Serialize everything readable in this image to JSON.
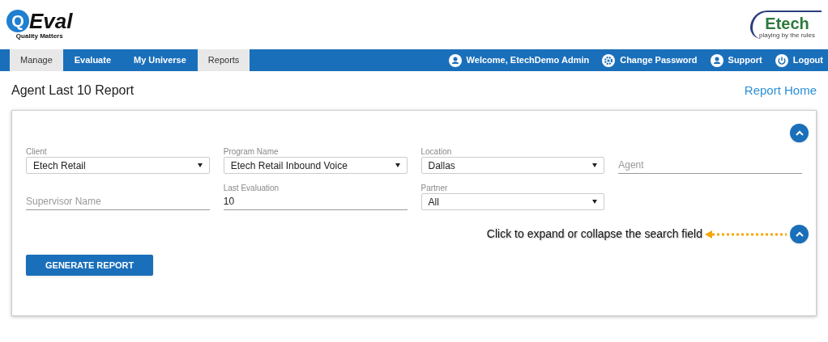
{
  "logo": {
    "mark": "Q",
    "name": "Eval",
    "tagline": "Quality Matters"
  },
  "partner_logo": {
    "name": "Etech",
    "tagline": "playing by the rules"
  },
  "nav": {
    "tabs": [
      {
        "label": "Manage",
        "selected": true
      },
      {
        "label": "Evaluate",
        "selected": false
      },
      {
        "label": "My Universe",
        "selected": false
      },
      {
        "label": "Reports",
        "selected": true
      }
    ],
    "links": [
      {
        "label": "Welcome, EtechDemo Admin",
        "kind": "user"
      },
      {
        "label": "Change Password",
        "kind": "gear"
      },
      {
        "label": "Support",
        "kind": "user"
      },
      {
        "label": "Logout",
        "kind": "power"
      }
    ]
  },
  "page": {
    "title": "Agent Last 10 Report",
    "home_link": "Report Home"
  },
  "fields": [
    {
      "kind": "select",
      "label": "Client",
      "value": "Etech Retail"
    },
    {
      "kind": "select",
      "label": "Program Name",
      "value": "Etech Retail Inbound Voice"
    },
    {
      "kind": "select",
      "label": "Location",
      "value": "Dallas"
    },
    {
      "kind": "text",
      "placeholder": "Agent"
    },
    {
      "kind": "text",
      "placeholder": "Supervisor Name"
    },
    {
      "kind": "text",
      "label": "Last Evaluation",
      "value": "10"
    },
    {
      "kind": "select",
      "label": "Partner",
      "value": "All"
    }
  ],
  "annotation": "Click to expand or collapse the search field",
  "generate_button": "GENERATE REPORT"
}
